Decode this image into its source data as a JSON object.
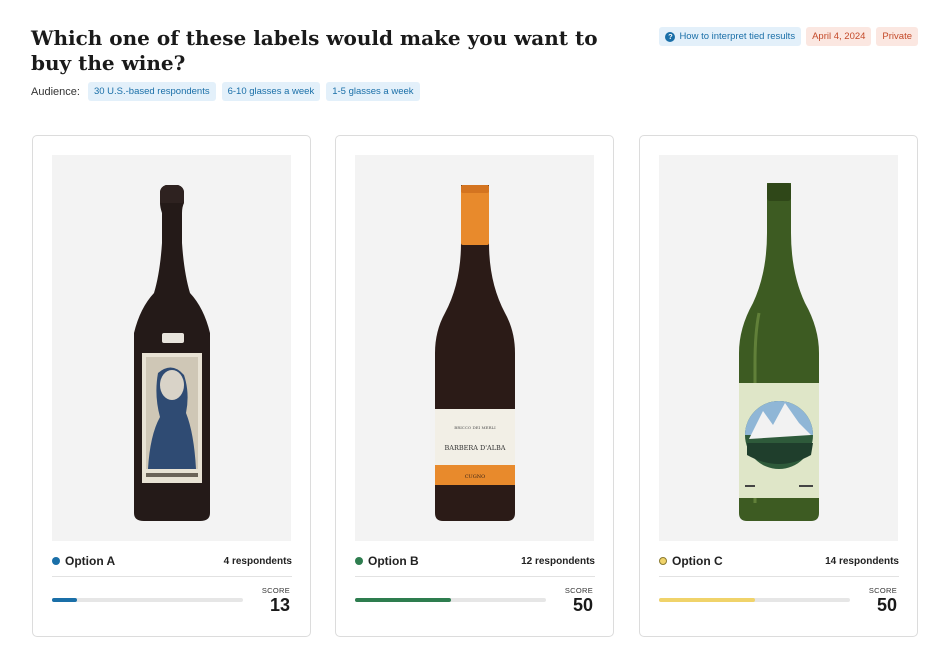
{
  "header": {
    "title": "Which one of these labels would make you want to buy the wine?",
    "audience_label": "Audience:",
    "audience_chips": [
      "30 U.S.-based respondents",
      "6-10 glasses a week",
      "1-5 glasses a week"
    ],
    "help_link": "How to interpret tied results",
    "date": "April 4, 2024",
    "visibility": "Private"
  },
  "options": [
    {
      "name": "Option A",
      "respondents": "4 respondents",
      "score_label": "SCORE",
      "score": 13,
      "color": "#1a6fa8",
      "fill_percent": 13,
      "image": "wine-bottle-dark-label-portrait"
    },
    {
      "name": "Option B",
      "respondents": "12 respondents",
      "score_label": "SCORE",
      "score": 50,
      "color": "#2e7d4f",
      "fill_percent": 50,
      "image": "wine-bottle-barbera-dalba"
    },
    {
      "name": "Option C",
      "respondents": "14 respondents",
      "score_label": "SCORE",
      "score": 50,
      "color": "#f0d36a",
      "fill_percent": 50,
      "image": "wine-bottle-green-mountain-label"
    }
  ],
  "bottle_text": {
    "b_brand": "BRICCO DEI MERLI",
    "b_name": "BARBERA D'ALBA",
    "b_maker": "CUGNO"
  }
}
